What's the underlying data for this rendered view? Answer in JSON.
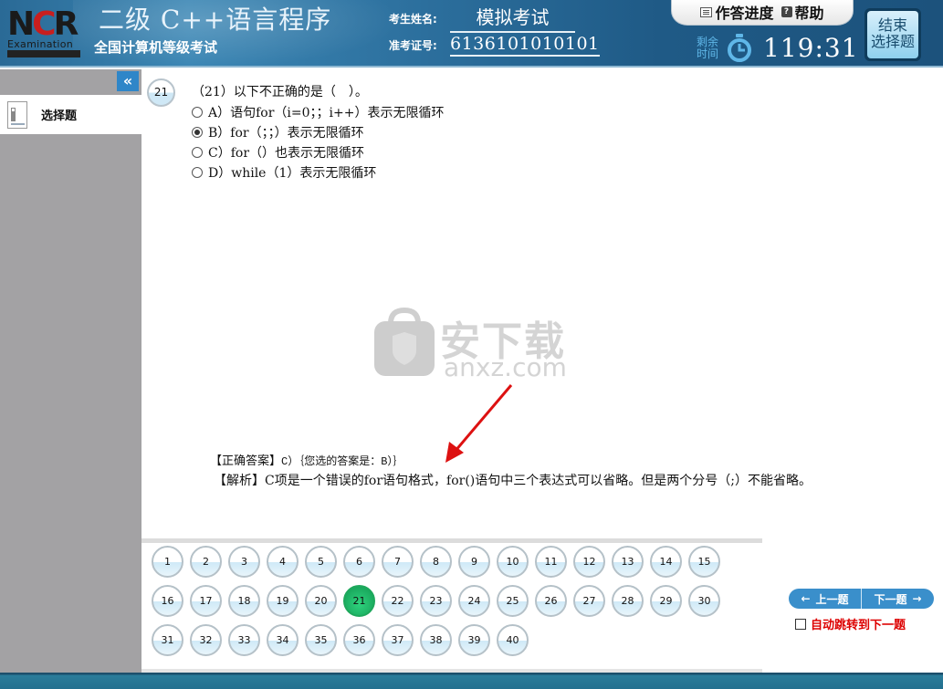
{
  "header": {
    "logo": {
      "mark": [
        "N",
        "C",
        "R"
      ],
      "word": "Examination"
    },
    "title": "二级  C++语言程序",
    "subtitle": "全国计算机等级考试",
    "name_label": "考生姓名:",
    "name_value": "模拟考试",
    "id_label": "准考证号:",
    "id_value": "6136101010101",
    "progress_label": "作答进度",
    "help_label": "帮助",
    "remaining_label_1": "剩余",
    "remaining_label_2": "时间",
    "timer": "119:31",
    "end_button_line1": "结束",
    "end_button_line2": "选择题"
  },
  "sidebar": {
    "collapse_icon": "«",
    "items": [
      {
        "label": "选择题",
        "icon": "document-list-icon"
      }
    ]
  },
  "question": {
    "number": "21",
    "text": "（21）以下不正确的是（　）。",
    "options": [
      {
        "key": "A",
        "text": "A）语句for（i=0；；i++）表示无限循环",
        "selected": false
      },
      {
        "key": "B",
        "text": "B）for（；；）表示无限循环",
        "selected": true
      },
      {
        "key": "C",
        "text": "C）for（）也表示无限循环",
        "selected": false
      },
      {
        "key": "D",
        "text": "D）while（1）表示无限循环",
        "selected": false
      }
    ]
  },
  "watermark": {
    "text": "安下载",
    "url_text": "anxz.com"
  },
  "answer": {
    "correct_label": "【正确答案】",
    "correct_value": "C）｛您选的答案是：B）｝",
    "analysis_label": "【解析】",
    "analysis_text": "C项是一个错误的for语句格式，for()语句中三个表达式可以省略。但是两个分号（;）不能省略。"
  },
  "question_grid": {
    "current": 21,
    "numbers": [
      1,
      2,
      3,
      4,
      5,
      6,
      7,
      8,
      9,
      10,
      11,
      12,
      13,
      14,
      15,
      16,
      17,
      18,
      19,
      20,
      21,
      22,
      23,
      24,
      25,
      26,
      27,
      28,
      29,
      30,
      31,
      32,
      33,
      34,
      35,
      36,
      37,
      38,
      39,
      40
    ]
  },
  "navigation": {
    "prev_label": "上一题",
    "next_label": "下一题",
    "auto_jump_label": "自动跳转到下一题",
    "auto_jump_checked": false
  },
  "colors": {
    "header_blue": "#2a6a96",
    "accent_blue": "#3a8fcb",
    "current_green": "#1ea85c",
    "auto_jump_red": "#dd0000",
    "sidebar_gray": "#a3a2a4"
  }
}
